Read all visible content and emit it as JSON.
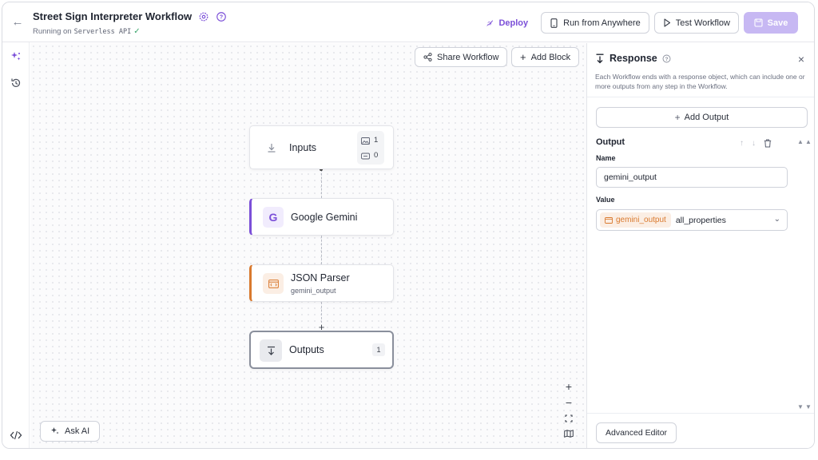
{
  "header": {
    "title": "Street Sign Interpreter Workflow",
    "running_prefix": "Running on",
    "running_target": "Serverless API",
    "deploy_label": "Deploy",
    "run_anywhere_label": "Run from Anywhere",
    "test_label": "Test Workflow",
    "save_label": "Save",
    "accent_color": "#7b4fd8"
  },
  "canvas": {
    "share_label": "Share Workflow",
    "add_block_label": "Add Block",
    "ask_ai_label": "Ask AI",
    "nodes": [
      {
        "label": "Inputs",
        "image_count": "1",
        "param_count": "0",
        "icon": "download-icon"
      },
      {
        "label": "Google Gemini",
        "icon": "google-g-icon",
        "accent": "#7b4fd8"
      },
      {
        "label": "JSON Parser",
        "sub": "gemini_output",
        "icon": "json-parser-icon",
        "accent": "#d9792e"
      },
      {
        "label": "Outputs",
        "count": "1",
        "icon": "output-arrow-icon"
      }
    ]
  },
  "panel": {
    "title": "Response",
    "description": "Each Workflow ends with a response object, which can include one or more outputs from any step in the Workflow.",
    "add_output_label": "Add Output",
    "output_title": "Output",
    "name_label": "Name",
    "name_value": "gemini_output",
    "value_label": "Value",
    "value_chip": "gemini_output",
    "value_property": "all_properties",
    "advanced_editor_label": "Advanced Editor"
  }
}
